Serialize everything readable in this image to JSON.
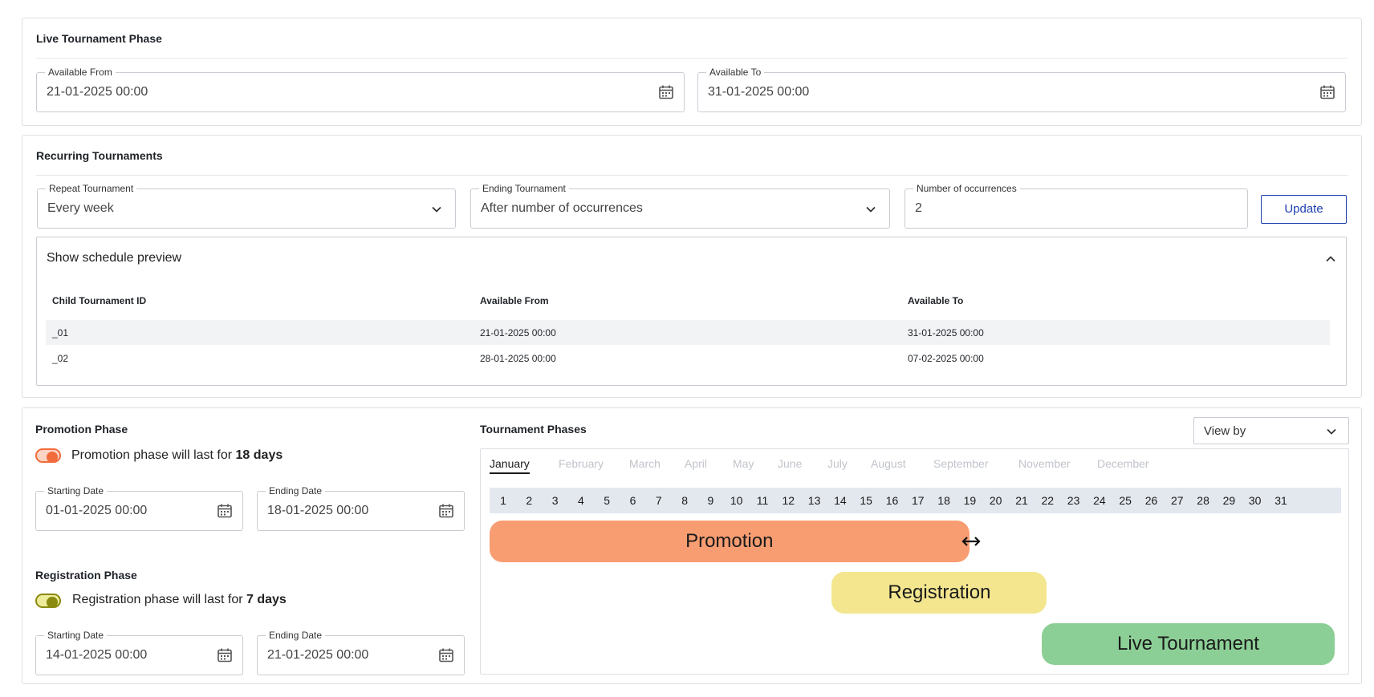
{
  "live_phase": {
    "title": "Live Tournament Phase",
    "available_from": {
      "label": "Available From",
      "value": "21-01-2025 00:00"
    },
    "available_to": {
      "label": "Available To",
      "value": "31-01-2025 00:00"
    }
  },
  "recurring": {
    "title": "Recurring Tournaments",
    "repeat": {
      "label": "Repeat Tournament",
      "value": "Every week"
    },
    "ending": {
      "label": "Ending Tournament",
      "value": "After number of occurrences"
    },
    "occurrences": {
      "label": "Number of occurrences",
      "value": "2"
    },
    "update_label": "Update",
    "preview": {
      "title": "Show schedule preview",
      "headers": [
        "Child Tournament ID",
        "Available From",
        "Available To"
      ],
      "rows": [
        [
          "_01",
          "21-01-2025 00:00",
          "31-01-2025 00:00"
        ],
        [
          "_02",
          "28-01-2025 00:00",
          "07-02-2025 00:00"
        ]
      ]
    }
  },
  "promotion": {
    "title": "Promotion Phase",
    "toggle_text": "Promotion phase will last for ",
    "duration": "18 days",
    "toggle_on": true,
    "toggle_color": "#f26b3a",
    "start": {
      "label": "Starting Date",
      "value": "01-01-2025 00:00"
    },
    "end": {
      "label": "Ending Date",
      "value": "18-01-2025 00:00"
    }
  },
  "registration": {
    "title": "Registration Phase",
    "toggle_text": "Registration phase will last for ",
    "duration": "7 days",
    "toggle_on": true,
    "toggle_color": "#8a8a10",
    "start": {
      "label": "Starting Date",
      "value": "14-01-2025 00:00"
    },
    "end": {
      "label": "Ending Date",
      "value": "21-01-2025 00:00"
    }
  },
  "phases_panel": {
    "title": "Tournament Phases",
    "view_by_label": "View by",
    "months": [
      "January",
      "February",
      "March",
      "April",
      "May",
      "June",
      "July",
      "August",
      "September",
      "November",
      "December"
    ],
    "active_month": "January",
    "days": [
      "1",
      "2",
      "3",
      "4",
      "5",
      "6",
      "7",
      "8",
      "9",
      "10",
      "11",
      "12",
      "13",
      "14",
      "15",
      "16",
      "17",
      "18",
      "19",
      "20",
      "21",
      "22",
      "23",
      "24",
      "25",
      "26",
      "27",
      "28",
      "29",
      "30",
      "31"
    ],
    "bars": [
      {
        "name": "Promotion",
        "start_day": 1,
        "end_day": 19.5,
        "color": "#f89d72"
      },
      {
        "name": "Registration",
        "start_day": 14.2,
        "end_day": 22.5,
        "color": "#f3e68f"
      },
      {
        "name": "Live Tournament",
        "start_day": 22.3,
        "end_day": 33.6,
        "color": "#8ccf96"
      }
    ]
  }
}
